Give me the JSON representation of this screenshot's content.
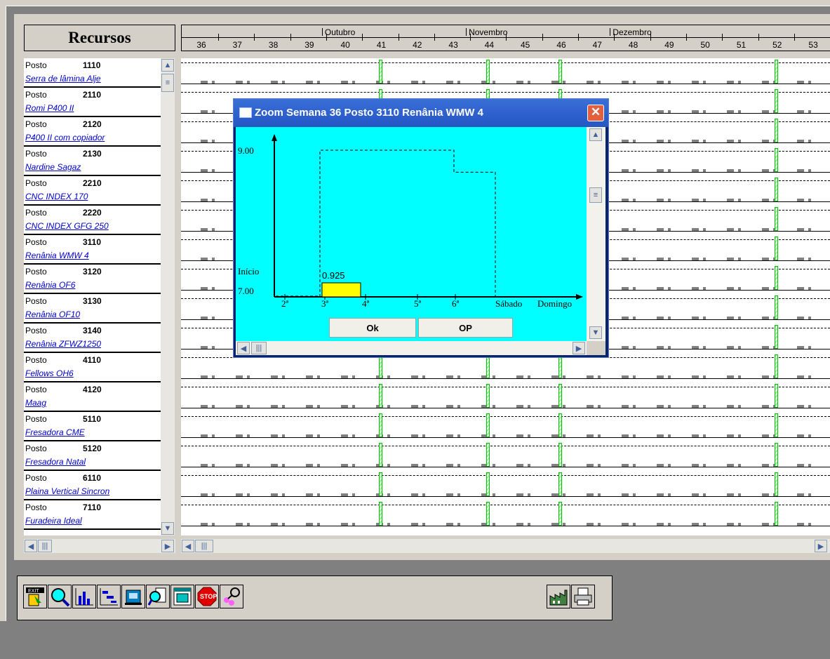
{
  "header": {
    "resources_title": "Recursos"
  },
  "timeline": {
    "months": [
      {
        "label": "Outubro",
        "week_after": 39
      },
      {
        "label": "Novembro",
        "week_after": 43
      },
      {
        "label": "Dezembro",
        "week_after": 47
      }
    ],
    "weeks": [
      "36",
      "37",
      "38",
      "39",
      "40",
      "41",
      "42",
      "43",
      "44",
      "45",
      "46",
      "47",
      "48",
      "49",
      "50",
      "51",
      "52",
      "53"
    ],
    "marked_weeks": [
      41,
      44,
      46,
      52
    ]
  },
  "resources": [
    {
      "label": "Posto",
      "code": "1110",
      "name": "Serra de lâmina Alje"
    },
    {
      "label": "Posto",
      "code": "2110",
      "name": "Romi P400 II"
    },
    {
      "label": "Posto",
      "code": "2120",
      "name": "P400 II com copiador"
    },
    {
      "label": "Posto",
      "code": "2130",
      "name": "Nardine Sagaz"
    },
    {
      "label": "Posto",
      "code": "2210",
      "name": "CNC INDEX 170"
    },
    {
      "label": "Posto",
      "code": "2220",
      "name": "CNC INDEX GFG 250"
    },
    {
      "label": "Posto",
      "code": "3110",
      "name": "Renânia WMW 4"
    },
    {
      "label": "Posto",
      "code": "3120",
      "name": "Renânia OF6"
    },
    {
      "label": "Posto",
      "code": "3130",
      "name": "Renânia OF10"
    },
    {
      "label": "Posto",
      "code": "3140",
      "name": "Renânia ZFWZ1250"
    },
    {
      "label": "Posto",
      "code": "4110",
      "name": "Fellows OH6"
    },
    {
      "label": "Posto",
      "code": "4120",
      "name": "Maag"
    },
    {
      "label": "Posto",
      "code": "5110",
      "name": "Fresadora CME"
    },
    {
      "label": "Posto",
      "code": "5120",
      "name": "Fresadora Natal"
    },
    {
      "label": "Posto",
      "code": "6110",
      "name": "Plaina Vertical Sincron"
    },
    {
      "label": "Posto",
      "code": "7110",
      "name": "Furadeira Ideal"
    }
  ],
  "dialog": {
    "title": "Zoom Semana 36 Posto  3110 Renânia WMW 4",
    "ok_label": "Ok",
    "op_label": "OP"
  },
  "chart_data": {
    "type": "bar",
    "categories": [
      "2ª",
      "3ª",
      "4ª",
      "5ª",
      "6ª",
      "Sábado",
      "Domingo"
    ],
    "y_tick_labels": [
      "9.00",
      "7.00"
    ],
    "start_label": "Início",
    "bar": {
      "day_start": "3ª",
      "value": 0.925,
      "label": "0.925",
      "color": "#ffff00"
    },
    "capacity_line": [
      {
        "day": "3ª",
        "hours": 9.0
      },
      {
        "day": "6ª",
        "hours": 8.7
      }
    ],
    "ylim": [
      7.0,
      9.0
    ]
  },
  "toolbar": {
    "icons": [
      "exit-icon",
      "search-icon",
      "bar-chart-icon",
      "gantt-icon",
      "machine-icon",
      "zoom-document-icon",
      "window-icon",
      "stop-icon",
      "people-search-icon"
    ],
    "right_icons": [
      "factory-icon",
      "printer-icon"
    ]
  },
  "colors": {
    "grid_marker": "#00c000",
    "chart_bg": "#00ffff",
    "link_text": "#0000cc"
  }
}
